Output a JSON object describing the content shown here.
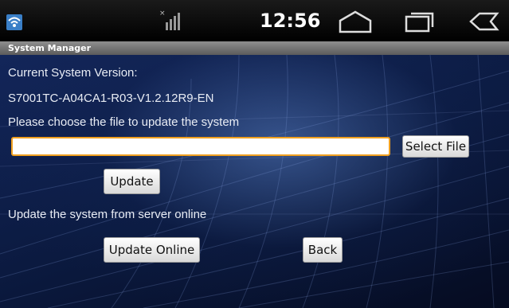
{
  "status_bar": {
    "time": "12:56",
    "icons": [
      "wifi-icon",
      "signal-icon",
      "home-icon",
      "recent-apps-icon",
      "back-icon"
    ]
  },
  "window": {
    "title": "System Manager"
  },
  "main": {
    "version_label": "Current System Version:",
    "version_value": "S7001TC-A04CA1-R03-V1.2.12R9-EN",
    "choose_file_label": "Please choose the file to update the system",
    "file_path_value": "",
    "select_file_button": "Select File",
    "update_button": "Update",
    "online_label": "Update the system from server online",
    "update_online_button": "Update Online",
    "back_button": "Back"
  },
  "colors": {
    "input_focus_border": "#f0a020",
    "status_bar_bg": "#000000",
    "title_bar_bg": "#7a7a7a"
  }
}
